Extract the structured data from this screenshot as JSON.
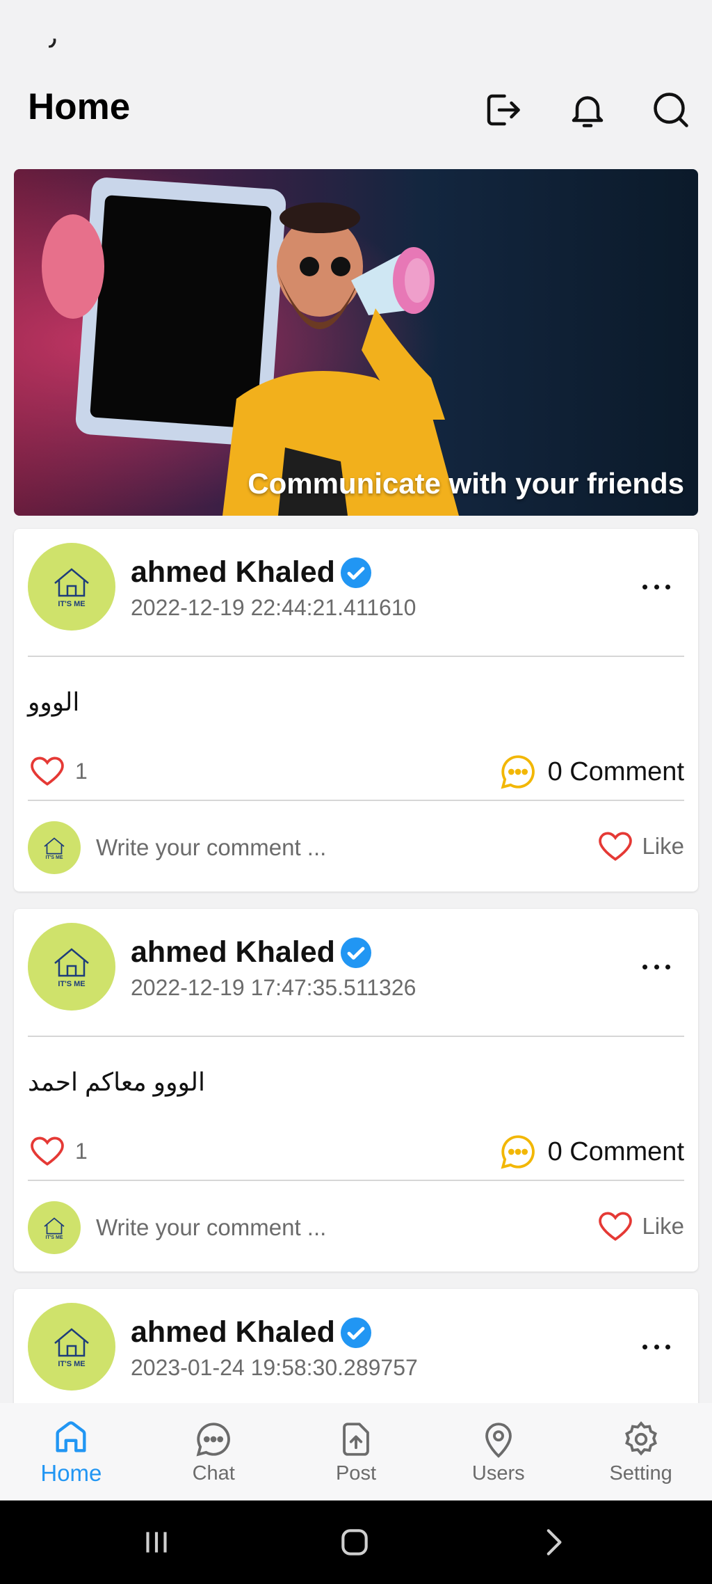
{
  "status_bar": {
    "mark": "٫"
  },
  "header": {
    "title": "Home",
    "icons": [
      "logout-icon",
      "bell-icon",
      "search-icon"
    ]
  },
  "banner": {
    "caption": "Communicate with your friends"
  },
  "posts": [
    {
      "author": "ahmed Khaled",
      "time": "2022-12-19 22:44:21.411610",
      "text": "الووو",
      "likes": "1",
      "comments": "0 Comment",
      "comment_placeholder": "Write your comment ...",
      "like_label": "Like",
      "avatar_text": "IT'S ME"
    },
    {
      "author": "ahmed Khaled",
      "time": "2022-12-19 17:47:35.511326",
      "text": "الووو معاكم احمد",
      "likes": "1",
      "comments": "0 Comment",
      "comment_placeholder": "Write your comment ...",
      "like_label": "Like",
      "avatar_text": "IT'S ME"
    },
    {
      "author": "ahmed Khaled",
      "time": "2023-01-24 19:58:30.289757",
      "avatar_text": "IT'S ME"
    }
  ],
  "bottom_nav": [
    {
      "label": "Home",
      "icon": "home-icon",
      "active": true
    },
    {
      "label": "Chat",
      "icon": "chat-icon",
      "active": false
    },
    {
      "label": "Post",
      "icon": "upload-icon",
      "active": false
    },
    {
      "label": "Users",
      "icon": "location-pin-icon",
      "active": false
    },
    {
      "label": "Setting",
      "icon": "gear-icon",
      "active": false
    }
  ],
  "colors": {
    "accent": "#2196f3",
    "heart": "#e53935",
    "comment": "#f2b705",
    "avatar_bg": "#cfe26b"
  }
}
